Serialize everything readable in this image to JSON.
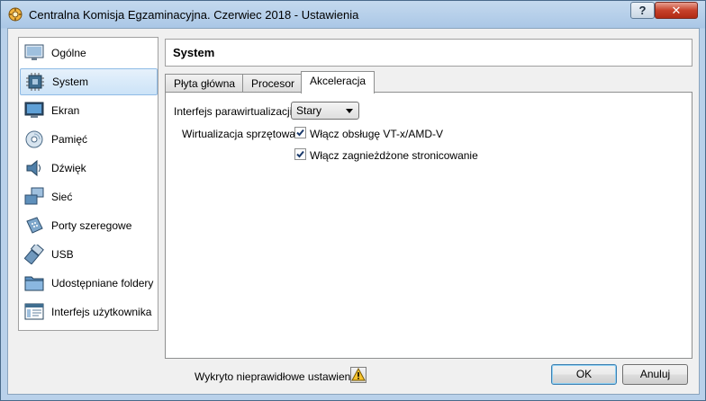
{
  "window": {
    "title": "Centralna Komisja Egzaminacyjna. Czerwiec 2018 - Ustawienia",
    "help_label": "?",
    "close_label": "✕"
  },
  "sidebar": {
    "items": [
      {
        "label": "Ogólne",
        "icon": "monitor-general-icon"
      },
      {
        "label": "System",
        "icon": "chip-icon",
        "selected": true
      },
      {
        "label": "Ekran",
        "icon": "display-icon"
      },
      {
        "label": "Pamięć",
        "icon": "disk-icon"
      },
      {
        "label": "Dźwięk",
        "icon": "speaker-icon"
      },
      {
        "label": "Sieć",
        "icon": "network-icon"
      },
      {
        "label": "Porty szeregowe",
        "icon": "serial-port-icon"
      },
      {
        "label": "USB",
        "icon": "usb-icon"
      },
      {
        "label": "Udostępniane foldery",
        "icon": "folder-icon"
      },
      {
        "label": "Interfejs użytkownika",
        "icon": "user-interface-icon"
      }
    ]
  },
  "main": {
    "title": "System",
    "tabs": [
      {
        "label": "Płyta główna",
        "active": false
      },
      {
        "label": "Procesor",
        "active": false
      },
      {
        "label": "Akceleracja",
        "active": true
      }
    ],
    "paravirt_label": "Interfejs parawirtualizacji:",
    "paravirt_value": "Stary",
    "hw_virt_label": "Wirtualizacja sprzętowa:",
    "vtx_label": "Włącz obsługę VT-x/AMD-V",
    "vtx_checked": true,
    "nested_label": "Włącz zagnieżdżone stronicowanie",
    "nested_checked": true
  },
  "footer": {
    "warning_text": "Wykryto nieprawidłowe ustawienia",
    "ok_label": "OK",
    "cancel_label": "Anuluj"
  },
  "colors": {
    "selection": "#cce3f7",
    "title_bar": "#aac7e6",
    "close_button": "#c7412a"
  }
}
